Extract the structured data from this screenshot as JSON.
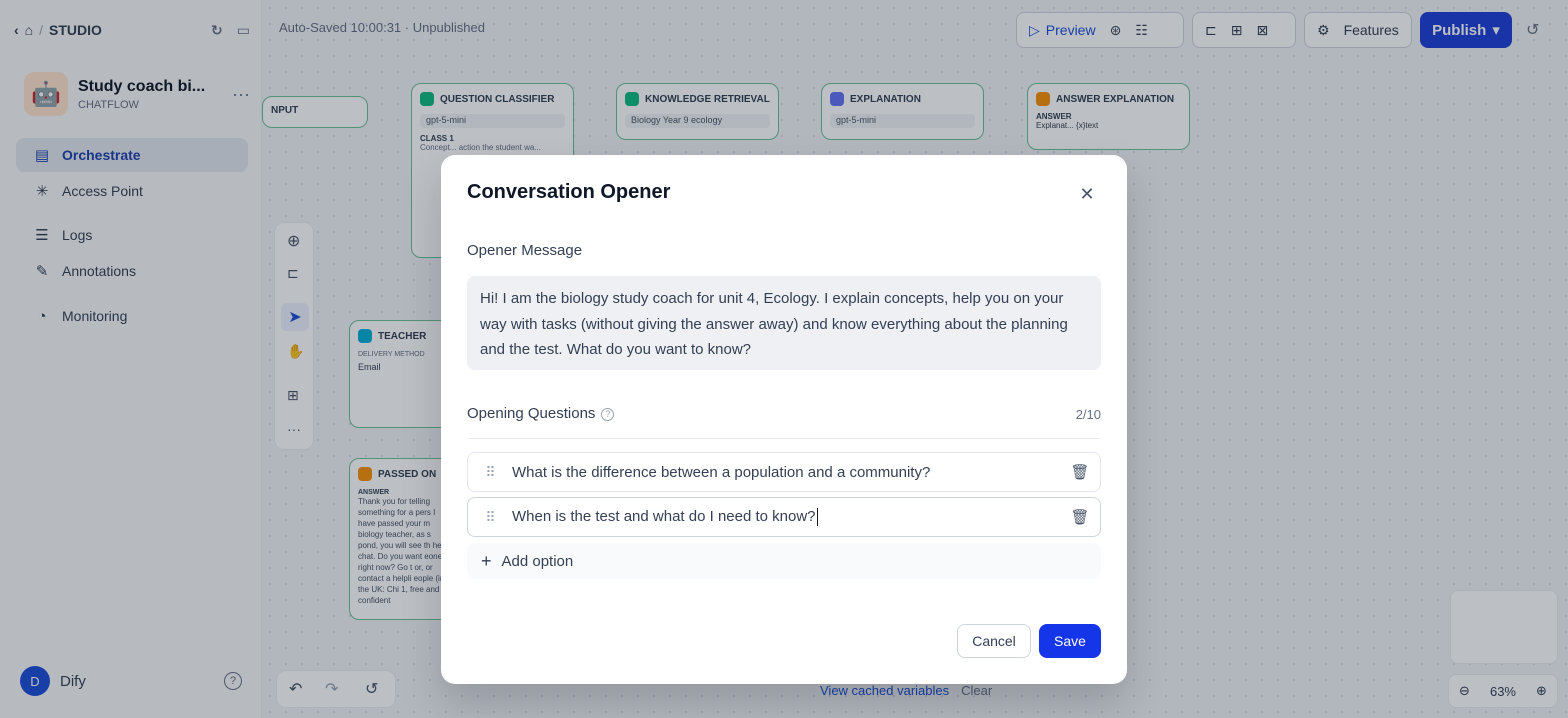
{
  "topnav": {
    "studio_label": "STUDIO"
  },
  "app": {
    "name": "Study coach bi...",
    "type": "CHATFLOW",
    "icon": "robot-emoji"
  },
  "sidebar": {
    "items": [
      {
        "label": "Orchestrate",
        "icon": "orchestrate-icon",
        "active": true
      },
      {
        "label": "Access Point",
        "icon": "access-point-icon"
      },
      {
        "label": "Logs",
        "icon": "logs-icon"
      },
      {
        "label": "Annotations",
        "icon": "annotations-icon"
      },
      {
        "label": "Monitoring",
        "icon": "monitoring-icon"
      }
    ],
    "user": {
      "initial": "D",
      "name": "Dify"
    }
  },
  "header": {
    "autosave": "Auto-Saved 10:00:31 · Unpublished",
    "preview_label": "Preview",
    "features_label": "Features",
    "publish_label": "Publish"
  },
  "canvas": {
    "nodes": {
      "input": "NPUT",
      "classifier": "QUESTION CLASSIFIER",
      "classifier_model": "gpt-5-mini",
      "classifier_class": "CLASS 1",
      "classifier_desc": "Concept... action the student wa...",
      "retrieval": "KNOWLEDGE RETRIEVAL",
      "retrieval_kb": "Biology Year 9 ecology",
      "explanation": "EXPLANATION",
      "explanation_model": "gpt-5-mini",
      "answer_expl": "ANSWER EXPLANATION",
      "answer_label": "ANSWER",
      "answer_var": "Explanat... {x}text",
      "teacher": "TEACHER",
      "teacher_delivery": "DELIVERY METHOD",
      "teacher_email": "Email",
      "passed": "PASSED ON",
      "passed_answer": "ANSWER",
      "passed_text": "Thank you for telling something for a pers I have passed your m biology teacher, as s pond, you will see th he chat. Do you want eone right now? Go t or, or contact a helpli eople (in the UK: Chi 1, free and confident"
    },
    "cached_label": "View cached variables",
    "clear_label": "Clear",
    "zoom": "63%"
  },
  "modal": {
    "title": "Conversation Opener",
    "opener_label": "Opener Message",
    "opener_text": "Hi! I am the biology study coach for unit 4, Ecology. I explain concepts, help you on your way with tasks (without giving the answer away) and know everything about the planning and the test. What do you want to know?",
    "questions_label": "Opening Questions",
    "questions_count": "2/10",
    "questions": [
      "What is the difference between a population and a community?",
      "When is the test and what do I need to know?"
    ],
    "add_option_label": "Add option",
    "cancel_label": "Cancel",
    "save_label": "Save"
  },
  "colors": {
    "accent": "#1535e8",
    "node_border": "#6cbf9a"
  }
}
